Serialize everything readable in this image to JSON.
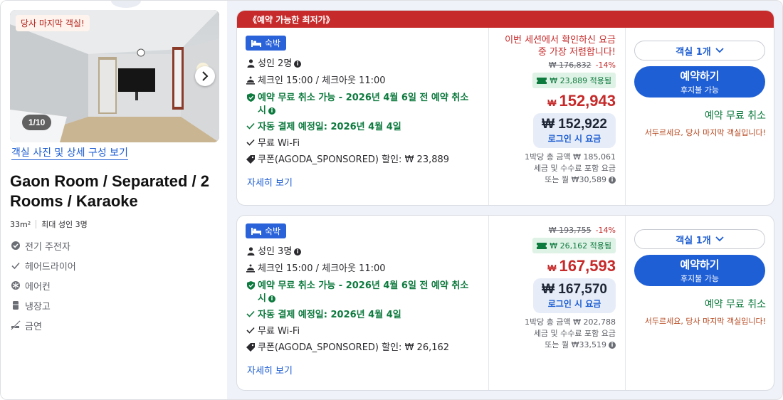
{
  "photo": {
    "badge": "당사 마지막 객실!",
    "counter": "1/10",
    "link": "객실 사진 및 상세 구성 보기"
  },
  "room": {
    "title": "Gaon Room / Separated / 2 Rooms / Karaoke",
    "size": "33m²",
    "max_guests": "최대 성인 3명",
    "amenities": [
      {
        "label": "전기 주전자",
        "icon": "kettle-icon"
      },
      {
        "label": "헤어드라이어",
        "icon": "check-icon"
      },
      {
        "label": "에어컨",
        "icon": "snowflake-icon"
      },
      {
        "label": "냉장고",
        "icon": "fridge-icon"
      },
      {
        "label": "금연",
        "icon": "no-smoking-icon"
      }
    ]
  },
  "offers": [
    {
      "ribbon": "《예약 가능한 최저가》",
      "stay_badge": "숙박",
      "guests": "성인 2명",
      "check_times": "체크인 15:00 / 체크아웃 11:00",
      "cancel_policy": "예약 무료 취소 가능 - 2026년 4월 6일 전 예약 취소 시",
      "auto_pay": "자동 결제 예정일: 2026년 4월 4일",
      "wifi": "무료 Wi-Fi",
      "coupon": "쿠폰(AGODA_SPONSORED) 할인: ₩ 23,889",
      "more": "자세히 보기",
      "session_msg": "이번 세션에서 확인하신 요금 중 가장 저렴합니다!",
      "original_price": "₩ 176,832",
      "discount_pct": "-14%",
      "coupon_applied": "₩ 23,889 적용됨",
      "currency": "₩",
      "price": "152,943",
      "login_price": "₩ 152,922",
      "login_label": "로그인 시 요금",
      "total_line": "1박당 총 금액 ₩ 185,061",
      "tax_line": "세금 및 수수료 포함 요금",
      "monthly_line": "또는 월 ₩30,589",
      "room_select": "객실 1개",
      "book_label": "예약하기",
      "book_sub": "후지불 가능",
      "free_cancel": "예약 무료 취소",
      "hurry": "서두르세요, 당사 마지막 객실입니다!"
    },
    {
      "stay_badge": "숙박",
      "guests": "성인 3명",
      "check_times": "체크인 15:00 / 체크아웃 11:00",
      "cancel_policy": "예약 무료 취소 가능 - 2026년 4월 6일 전 예약 취소 시",
      "auto_pay": "자동 결제 예정일: 2026년 4월 4일",
      "wifi": "무료 Wi-Fi",
      "coupon": "쿠폰(AGODA_SPONSORED) 할인: ₩ 26,162",
      "more": "자세히 보기",
      "original_price": "₩ 193,755",
      "discount_pct": "-14%",
      "coupon_applied": "₩ 26,162 적용됨",
      "currency": "₩",
      "price": "167,593",
      "login_price": "₩ 167,570",
      "login_label": "로그인 시 요금",
      "total_line": "1박당 총 금액 ₩ 202,788",
      "tax_line": "세금 및 수수료 포함 요금",
      "monthly_line": "또는 월 ₩33,519",
      "room_select": "객실 1개",
      "book_label": "예약하기",
      "book_sub": "후지불 가능",
      "free_cancel": "예약 무료 취소",
      "hurry": "서두르세요, 당사 마지막 객실입니다!"
    }
  ],
  "colors": {
    "accent_blue": "#1f5fd6",
    "price_red": "#c62a2a",
    "cancel_green": "#0d7a3e",
    "panel_bg": "#eff2f8"
  }
}
